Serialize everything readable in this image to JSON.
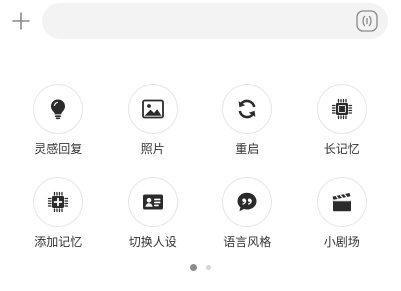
{
  "composer": {
    "input_value": "",
    "plus_icon": "plus-icon",
    "voice_icon": "voice-wave-icon"
  },
  "menu": {
    "items": [
      {
        "label": "灵感回复",
        "icon": "lightbulb-icon"
      },
      {
        "label": "照片",
        "icon": "image-icon"
      },
      {
        "label": "重启",
        "icon": "refresh-icon"
      },
      {
        "label": "长记忆",
        "icon": "chip-icon"
      },
      {
        "label": "添加记忆",
        "icon": "chip-add-icon"
      },
      {
        "label": "切换人设",
        "icon": "id-card-icon"
      },
      {
        "label": "语言风格",
        "icon": "quote-bubble-icon"
      },
      {
        "label": "小剧场",
        "icon": "clapperboard-icon"
      }
    ]
  },
  "pager": {
    "page_count": 2,
    "current_page": 1
  },
  "colors": {
    "icon": "#2b2b2b",
    "input_bg": "#f3f3f3",
    "circle_border": "#e6e6e6",
    "dot_active": "#8c8c8c",
    "dot_inactive": "#d6d6d6"
  }
}
